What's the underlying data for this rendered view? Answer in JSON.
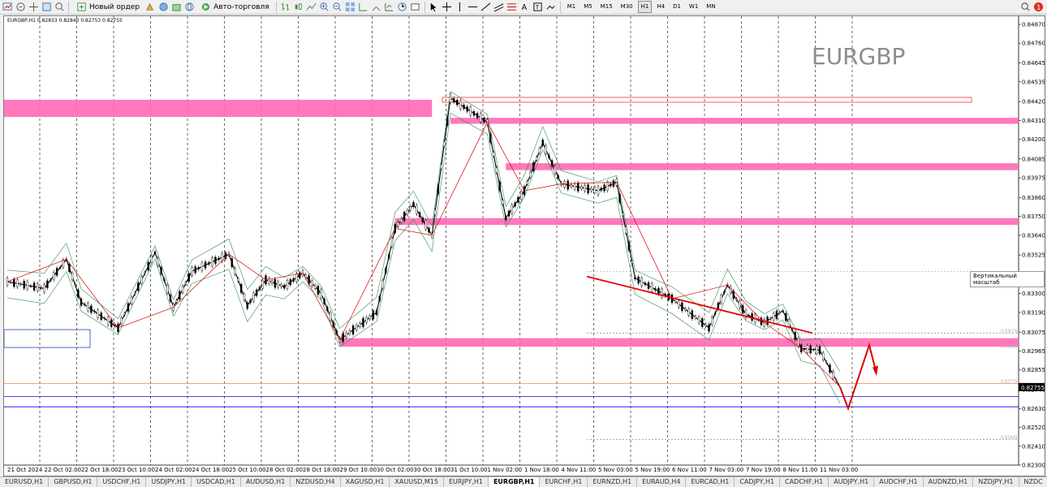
{
  "toolbar": {
    "new_order_label": "Новый ордер",
    "autotrading_label": "Авто-торговля",
    "timeframes": [
      "M1",
      "M5",
      "M15",
      "M30",
      "H1",
      "H4",
      "D1",
      "W1",
      "MN"
    ],
    "active_timeframe": "H1",
    "notification_count": "1"
  },
  "chart": {
    "header": "EURGBP,H1  0.82833 0.82840 0.82753 0.82755",
    "watermark": "EURGBP",
    "scale_tooltip": "Вертикальный масштаб",
    "current_price_label": "0.82755"
  },
  "chart_data": {
    "type": "candlestick",
    "symbol": "EURGBP",
    "timeframe": "H1",
    "last_bar": {
      "open": 0.82833,
      "high": 0.8284,
      "low": 0.82753,
      "close": 0.82755
    },
    "y_ticks": [
      "0.84870",
      "0.84760",
      "0.84645",
      "0.84535",
      "0.84420",
      "0.84310",
      "0.84200",
      "0.84085",
      "0.83975",
      "0.83860",
      "0.83750",
      "0.83640",
      "0.83525",
      "0.83415",
      "0.83300",
      "0.83190",
      "0.83075",
      "0.82965",
      "0.82855",
      "0.82740",
      "0.82630",
      "0.82520",
      "0.82410",
      "0.82300"
    ],
    "x_ticks": [
      "21 Oct 2024",
      "22 Oct 02:00",
      "22 Oct 18:00",
      "23 Oct 10:00",
      "24 Oct 02:00",
      "24 Oct 18:00",
      "25 Oct 10:00",
      "28 Oct 02:00",
      "28 Oct 18:00",
      "29 Oct 10:00",
      "30 Oct 02:00",
      "30 Oct 18:00",
      "31 Oct 10:00",
      "1 Nov 02:00",
      "1 Nov 18:00",
      "4 Nov 11:00",
      "5 Nov 03:00",
      "5 Nov 19:00",
      "6 Nov 11:00",
      "7 Nov 03:00",
      "7 Nov 19:00",
      "8 Nov 11:00",
      "11 Nov 03:00"
    ],
    "ylim": [
      0.823,
      0.8487
    ],
    "price_path": [
      {
        "x": "21 Oct 2024",
        "y": 0.8337
      },
      {
        "x": "22 Oct 02:00",
        "y": 0.8333
      },
      {
        "x": "22 Oct 12:00",
        "y": 0.835
      },
      {
        "x": "22 Oct 18:00",
        "y": 0.8325
      },
      {
        "x": "23 Oct 10:00",
        "y": 0.831
      },
      {
        "x": "24 Oct 02:00",
        "y": 0.8354
      },
      {
        "x": "24 Oct 10:00",
        "y": 0.8322
      },
      {
        "x": "24 Oct 18:00",
        "y": 0.8343
      },
      {
        "x": "25 Oct 10:00",
        "y": 0.8353
      },
      {
        "x": "25 Oct 18:00",
        "y": 0.8323
      },
      {
        "x": "28 Oct 02:00",
        "y": 0.8338
      },
      {
        "x": "28 Oct 10:00",
        "y": 0.8334
      },
      {
        "x": "28 Oct 18:00",
        "y": 0.8342
      },
      {
        "x": "29 Oct 02:00",
        "y": 0.833
      },
      {
        "x": "29 Oct 10:00",
        "y": 0.8303
      },
      {
        "x": "30 Oct 02:00",
        "y": 0.8319
      },
      {
        "x": "30 Oct 10:00",
        "y": 0.8368
      },
      {
        "x": "30 Oct 18:00",
        "y": 0.8382
      },
      {
        "x": "31 Oct 02:00",
        "y": 0.8364
      },
      {
        "x": "31 Oct 10:00",
        "y": 0.8444
      },
      {
        "x": "1 Nov 02:00",
        "y": 0.843
      },
      {
        "x": "1 Nov 10:00",
        "y": 0.8374
      },
      {
        "x": "1 Nov 18:00",
        "y": 0.839
      },
      {
        "x": "4 Nov 03:00",
        "y": 0.8418
      },
      {
        "x": "4 Nov 11:00",
        "y": 0.8394
      },
      {
        "x": "5 Nov 03:00",
        "y": 0.839
      },
      {
        "x": "5 Nov 11:00",
        "y": 0.8395
      },
      {
        "x": "5 Nov 19:00",
        "y": 0.8339
      },
      {
        "x": "6 Nov 11:00",
        "y": 0.8327
      },
      {
        "x": "7 Nov 03:00",
        "y": 0.831
      },
      {
        "x": "7 Nov 11:00",
        "y": 0.8335
      },
      {
        "x": "7 Nov 19:00",
        "y": 0.8318
      },
      {
        "x": "8 Nov 03:00",
        "y": 0.8313
      },
      {
        "x": "8 Nov 11:00",
        "y": 0.832
      },
      {
        "x": "8 Nov 19:00",
        "y": 0.8298
      },
      {
        "x": "11 Nov 03:00",
        "y": 0.8297
      },
      {
        "x": "11 Nov 12:00",
        "y": 0.82755
      }
    ],
    "horizontal_levels": [
      {
        "price": 0.8298,
        "label": "0.82980",
        "color": "#ff69b4"
      },
      {
        "price": 0.82775,
        "label": "0.82775",
        "color": "#ff7f50"
      },
      {
        "price": 0.827,
        "label": "",
        "color": "#0000ff"
      },
      {
        "price": 0.8264,
        "label": "",
        "color": "#0000ff"
      },
      {
        "price": 0.8307,
        "label": "0.83076",
        "color": "#999999"
      },
      {
        "price": 0.8245,
        "label": "0.82445",
        "color": "#999999"
      }
    ],
    "zones": [
      {
        "from": "21 Oct 2024",
        "to": "31 Oct 02:00",
        "price_top": 0.8443,
        "price_bottom": 0.8433,
        "color": "#ff69b4"
      },
      {
        "from": "31 Oct 10:00",
        "to": "11 Nov 12:00",
        "price_top": 0.84325,
        "price_bottom": 0.8429,
        "color": "#ff69b4"
      },
      {
        "from": "1 Nov 10:00",
        "to": "11 Nov 12:00",
        "price_top": 0.8406,
        "price_bottom": 0.8402,
        "color": "#ff69b4"
      },
      {
        "from": "30 Oct 10:00",
        "to": "11 Nov 12:00",
        "price_top": 0.8374,
        "price_bottom": 0.837,
        "color": "#ff69b4"
      },
      {
        "from": "29 Oct 10:00",
        "to": "11 Nov 12:00",
        "price_top": 0.8304,
        "price_bottom": 0.8299,
        "color": "#ff69b4"
      }
    ],
    "grid": true
  },
  "symbol_tabs": [
    "EURUSD,H1",
    "GBPUSD,H1",
    "USDCHF,H1",
    "USDJPY,H1",
    "USDCAD,H1",
    "AUDUSD,H1",
    "NZDUSD,H4",
    "XAGUSD,H1",
    "XAUUSD,M15",
    "EURJPY,H1",
    "EURGBP,H1",
    "EURCHF,H1",
    "EURNZD,H1",
    "EURAUD,H4",
    "EURCAD,H1",
    "CADJPY,H1",
    "CADCHF,H1",
    "AUDJPY,H1",
    "AUDCHF,H1",
    "AUDNZD,H1",
    "NZDJPY,H1",
    "NZDC"
  ],
  "active_tab": "EURGBP,H1"
}
